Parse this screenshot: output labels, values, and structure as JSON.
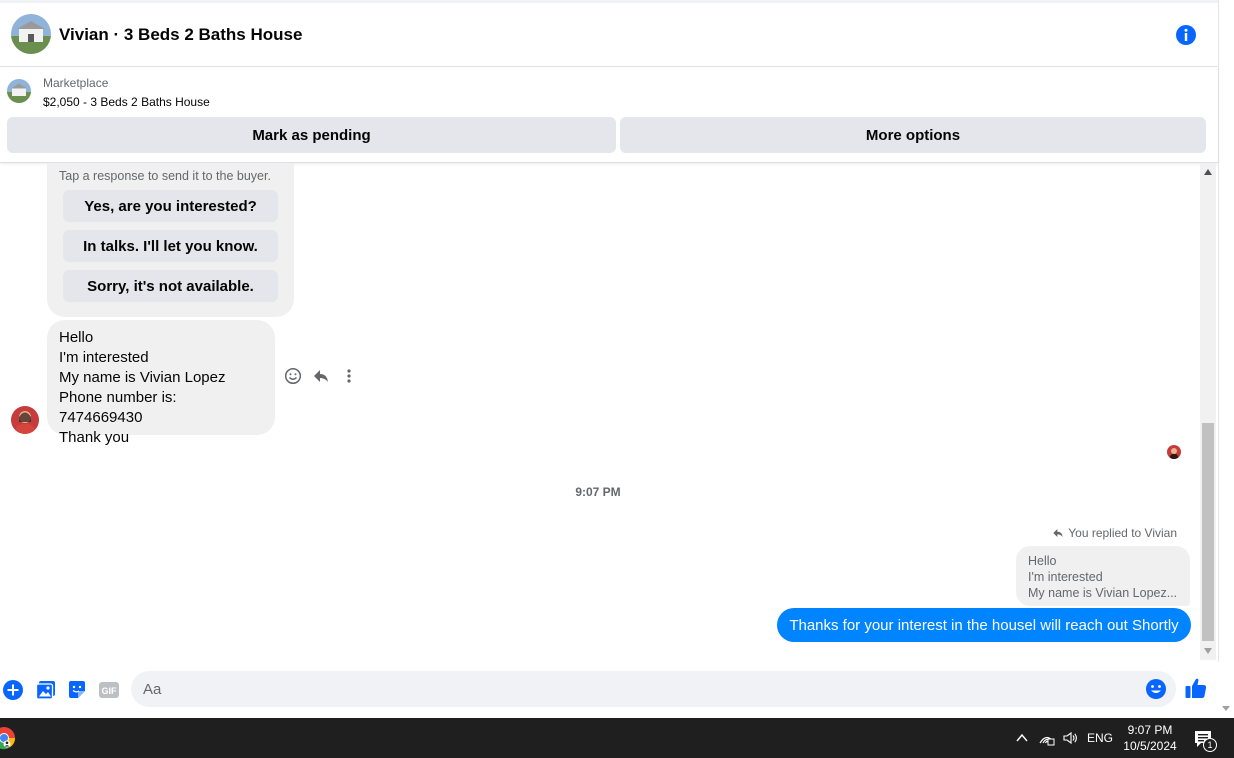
{
  "header": {
    "title": "Vivian · 3 Beds 2 Baths House",
    "info_icon": "info-icon"
  },
  "marketplace": {
    "label": "Marketplace",
    "listing": "$2,050 - 3 Beds 2 Baths House",
    "mark_pending_label": "Mark as pending",
    "more_options_label": "More options"
  },
  "quick_responses": {
    "tip": "Tap a response to send it to the buyer.",
    "options": [
      "Yes, are you interested?",
      "In talks. I'll let you know.",
      "Sorry, it's not available."
    ]
  },
  "incoming_message": {
    "lines": [
      "Hello",
      "I'm interested",
      "My name is Vivian Lopez",
      "Phone number is: 7474669430",
      "Thank you"
    ]
  },
  "timestamp": "9:07 PM",
  "reply": {
    "label": "You replied to Vivian",
    "quoted_lines": [
      "Hello",
      "I'm interested",
      "My name is Vivian Lopez..."
    ],
    "text": "Thanks for your interest in the housel will reach out Shortly"
  },
  "composer": {
    "placeholder": "Aa"
  },
  "taskbar": {
    "lang": "ENG",
    "time": "9:07 PM",
    "date": "10/5/2024",
    "notification_count": "1"
  },
  "colors": {
    "accent": "#0084ff",
    "messenger_blue": "#0866ff",
    "bubble_gray": "#f0f0f0",
    "button_gray": "#e4e6eb"
  }
}
